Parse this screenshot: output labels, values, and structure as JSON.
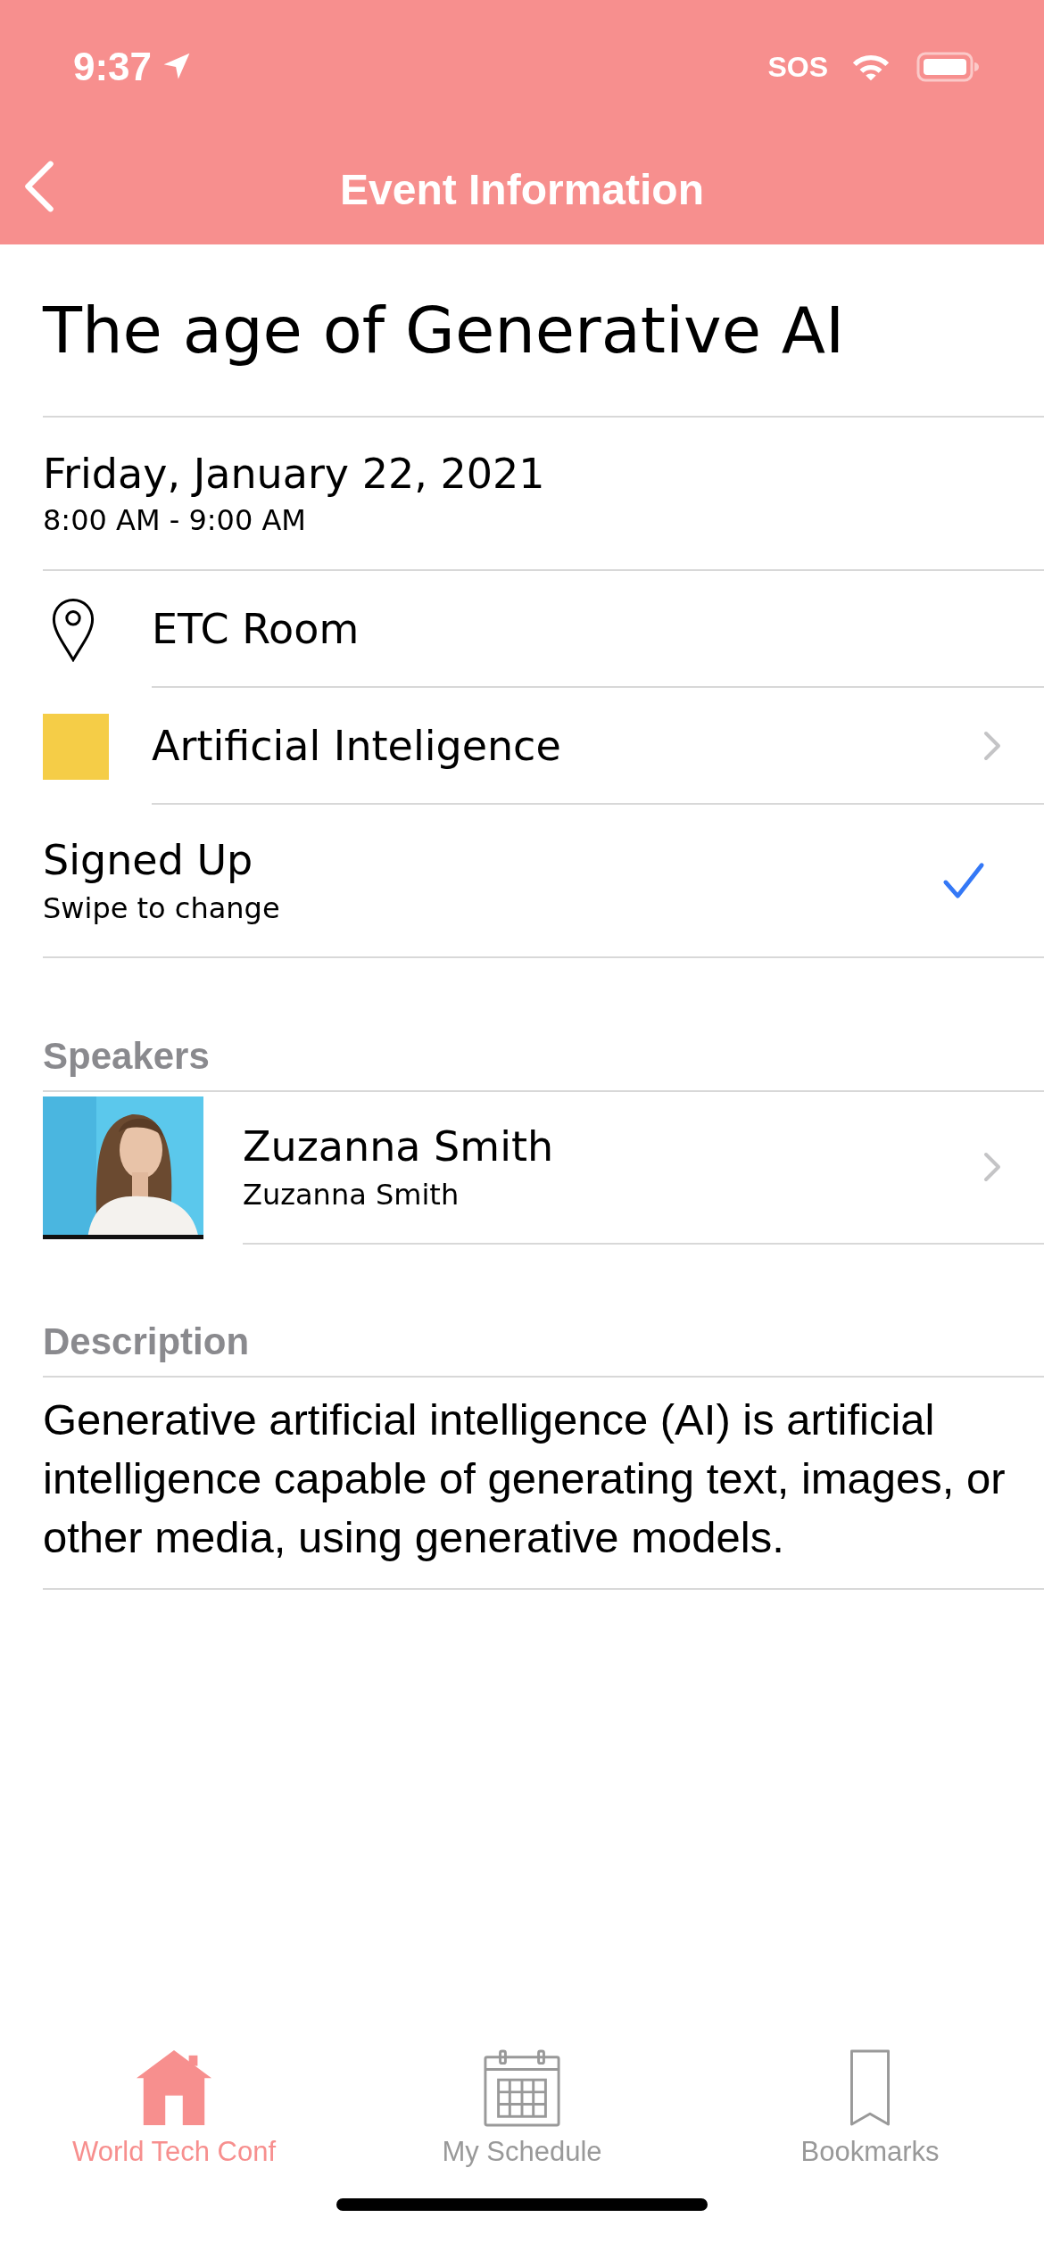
{
  "status_bar": {
    "time": "9:37",
    "sos": "SOS"
  },
  "nav": {
    "title": "Event Information"
  },
  "event": {
    "title": "The age of Generative AI",
    "date": "Friday, January 22, 2021",
    "time_range": "8:00 AM - 9:00 AM"
  },
  "location": {
    "label": "ETC Room"
  },
  "category": {
    "label": "Artificial Inteligence",
    "color": "#f5cd47"
  },
  "signup": {
    "label": "Signed Up",
    "hint": "Swipe to change",
    "checked": true
  },
  "speakers": {
    "header": "Speakers",
    "items": [
      {
        "name": "Zuzanna Smith",
        "subtitle": "Zuzanna Smith"
      }
    ]
  },
  "description": {
    "header": "Description",
    "text": "Generative artificial intelligence (AI) is artificial intelligence capable of generating text, images, or other media, using generative models."
  },
  "tab_bar": [
    {
      "label": "World Tech Conf",
      "kind": "home",
      "selected": true
    },
    {
      "label": "My Schedule",
      "kind": "calendar",
      "selected": false
    },
    {
      "label": "Bookmarks",
      "kind": "bookmark",
      "selected": false
    }
  ]
}
